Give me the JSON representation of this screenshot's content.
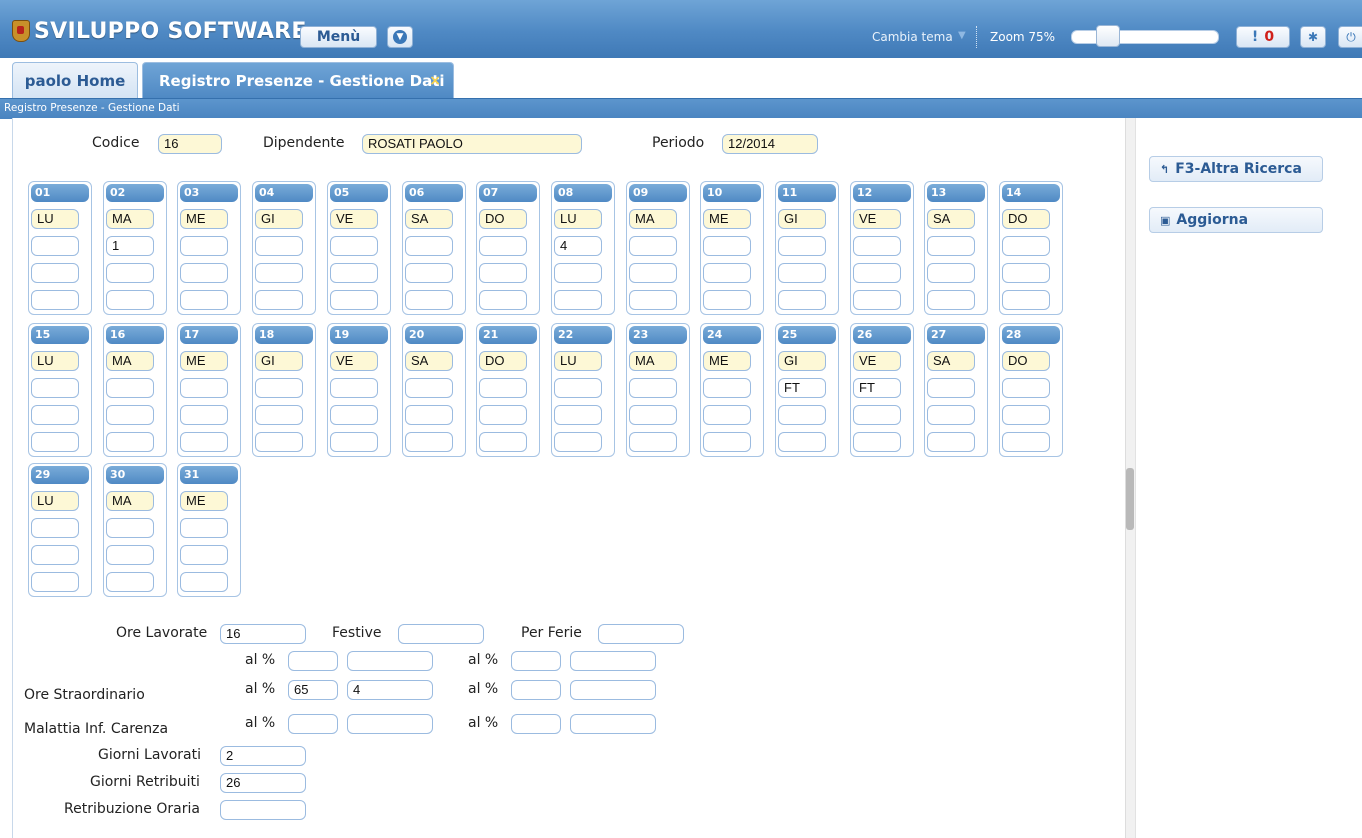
{
  "header": {
    "app_title": "SVILUPPO SOFTWARE",
    "menu_label": "Menù",
    "theme_label": "Cambia tema",
    "zoom_label": "Zoom 75%",
    "zoom_value": 0.75,
    "alert_symbol": "!",
    "alert_count": "0"
  },
  "tabs": [
    {
      "label": "paolo Home",
      "active": false
    },
    {
      "label": "Registro Presenze - Gestione Dati",
      "active": true,
      "close": "×"
    }
  ],
  "breadcrumb": "Registro Presenze - Gestione Dati",
  "form": {
    "codice_label": "Codice",
    "codice_value": "16",
    "dipendente_label": "Dipendente",
    "dipendente_value": "ROSATI PAOLO",
    "periodo_label": "Periodo",
    "periodo_value": "12/2014"
  },
  "days": [
    {
      "num": "01",
      "dow": "LU",
      "v1": "",
      "v2": "",
      "v3": ""
    },
    {
      "num": "02",
      "dow": "MA",
      "v1": "1",
      "v2": "",
      "v3": ""
    },
    {
      "num": "03",
      "dow": "ME",
      "v1": "",
      "v2": "",
      "v3": ""
    },
    {
      "num": "04",
      "dow": "GI",
      "v1": "",
      "v2": "",
      "v3": ""
    },
    {
      "num": "05",
      "dow": "VE",
      "v1": "",
      "v2": "",
      "v3": ""
    },
    {
      "num": "06",
      "dow": "SA",
      "v1": "",
      "v2": "",
      "v3": ""
    },
    {
      "num": "07",
      "dow": "DO",
      "v1": "",
      "v2": "",
      "v3": ""
    },
    {
      "num": "08",
      "dow": "LU",
      "v1": "4",
      "v2": "",
      "v3": ""
    },
    {
      "num": "09",
      "dow": "MA",
      "v1": "",
      "v2": "",
      "v3": ""
    },
    {
      "num": "10",
      "dow": "ME",
      "v1": "",
      "v2": "",
      "v3": ""
    },
    {
      "num": "11",
      "dow": "GI",
      "v1": "",
      "v2": "",
      "v3": ""
    },
    {
      "num": "12",
      "dow": "VE",
      "v1": "",
      "v2": "",
      "v3": ""
    },
    {
      "num": "13",
      "dow": "SA",
      "v1": "",
      "v2": "",
      "v3": ""
    },
    {
      "num": "14",
      "dow": "DO",
      "v1": "",
      "v2": "",
      "v3": ""
    },
    {
      "num": "15",
      "dow": "LU",
      "v1": "",
      "v2": "",
      "v3": ""
    },
    {
      "num": "16",
      "dow": "MA",
      "v1": "",
      "v2": "",
      "v3": ""
    },
    {
      "num": "17",
      "dow": "ME",
      "v1": "",
      "v2": "",
      "v3": ""
    },
    {
      "num": "18",
      "dow": "GI",
      "v1": "",
      "v2": "",
      "v3": ""
    },
    {
      "num": "19",
      "dow": "VE",
      "v1": "",
      "v2": "",
      "v3": ""
    },
    {
      "num": "20",
      "dow": "SA",
      "v1": "",
      "v2": "",
      "v3": ""
    },
    {
      "num": "21",
      "dow": "DO",
      "v1": "",
      "v2": "",
      "v3": ""
    },
    {
      "num": "22",
      "dow": "LU",
      "v1": "",
      "v2": "",
      "v3": ""
    },
    {
      "num": "23",
      "dow": "MA",
      "v1": "",
      "v2": "",
      "v3": ""
    },
    {
      "num": "24",
      "dow": "ME",
      "v1": "",
      "v2": "",
      "v3": ""
    },
    {
      "num": "25",
      "dow": "GI",
      "v1": "FT",
      "v2": "",
      "v3": ""
    },
    {
      "num": "26",
      "dow": "VE",
      "v1": "FT",
      "v2": "",
      "v3": ""
    },
    {
      "num": "27",
      "dow": "SA",
      "v1": "",
      "v2": "",
      "v3": ""
    },
    {
      "num": "28",
      "dow": "DO",
      "v1": "",
      "v2": "",
      "v3": ""
    },
    {
      "num": "29",
      "dow": "LU",
      "v1": "",
      "v2": "",
      "v3": ""
    },
    {
      "num": "30",
      "dow": "MA",
      "v1": "",
      "v2": "",
      "v3": ""
    },
    {
      "num": "31",
      "dow": "ME",
      "v1": "",
      "v2": "",
      "v3": ""
    }
  ],
  "summary": {
    "ore_lavorate_label": "Ore Lavorate",
    "ore_lavorate_value": "16",
    "festive_label": "Festive",
    "festive_value": "",
    "per_ferie_label": "Per Ferie",
    "per_ferie_value": "",
    "pct_label": "al %",
    "row1": {
      "pct_a": "",
      "val_a": "",
      "pct_b": "",
      "val_b": ""
    },
    "straordinario_label": "Ore Straordinario",
    "row2": {
      "pct_a": "65",
      "val_a": "4",
      "pct_b": "",
      "val_b": ""
    },
    "malattia_label": "Malattia Inf. Carenza",
    "row3": {
      "pct_a": "",
      "val_a": "",
      "pct_b": "",
      "val_b": ""
    },
    "giorni_lavorati_label": "Giorni Lavorati",
    "giorni_lavorati_value": "2",
    "giorni_retribuiti_label": "Giorni Retribuiti",
    "giorni_retribuiti_value": "26",
    "retribuzione_label": "Retribuzione Oraria",
    "retribuzione_value": ""
  },
  "actions": {
    "altra_ricerca": "F3-Altra Ricerca",
    "aggiorna": "Aggiorna"
  }
}
